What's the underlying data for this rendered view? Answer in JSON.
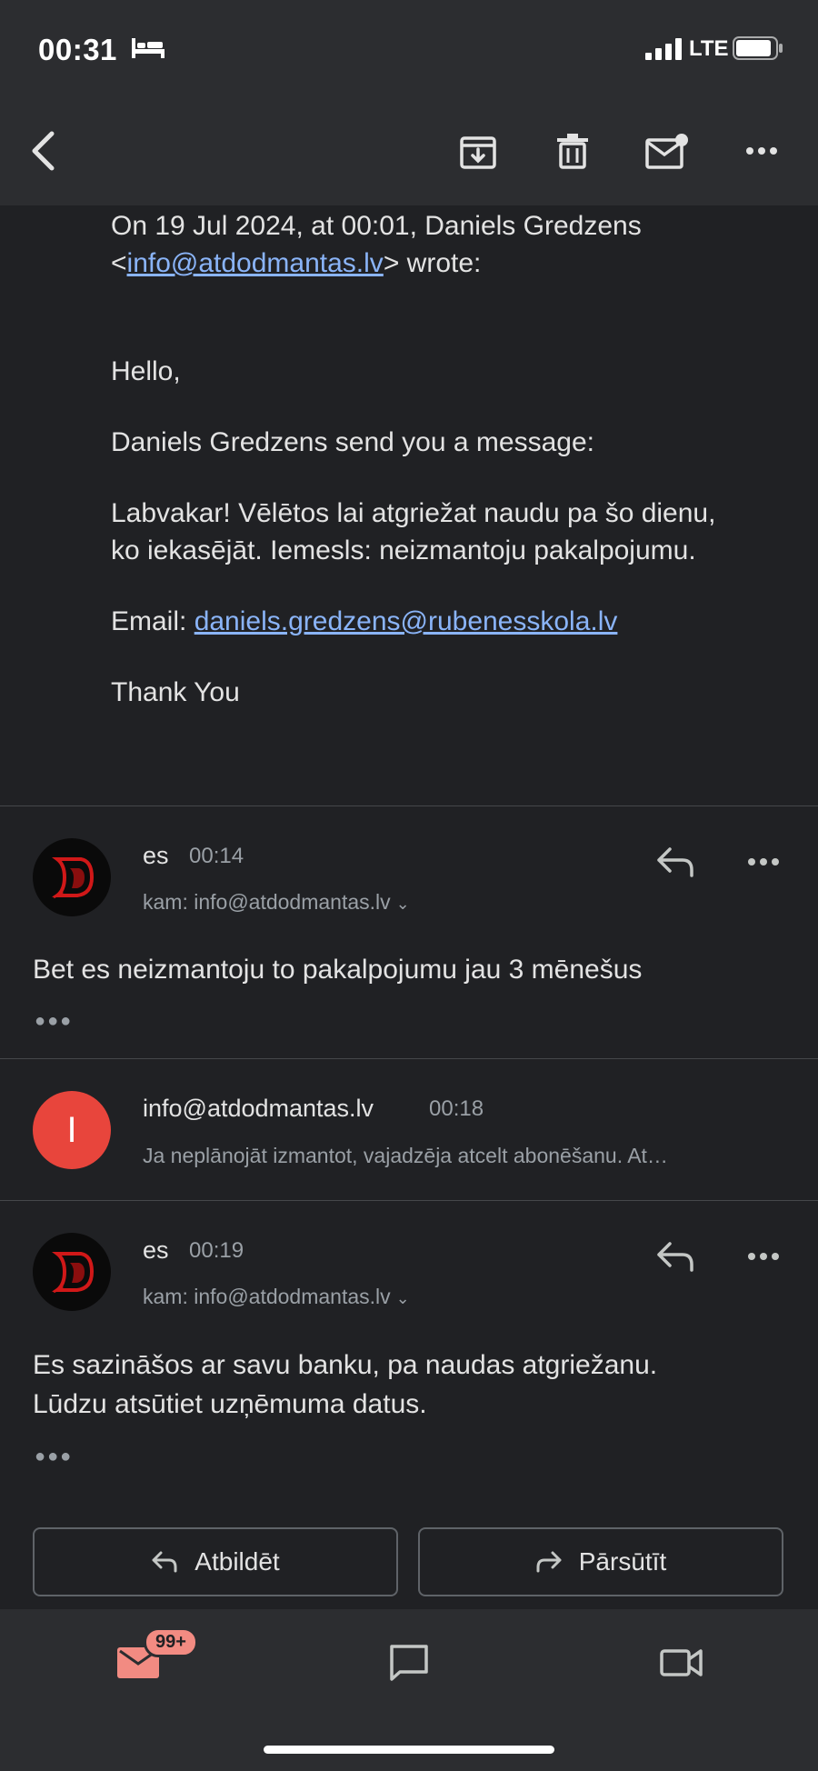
{
  "status": {
    "time": "00:31",
    "network": "LTE"
  },
  "toolbar": {
    "back": "back-icon",
    "archive": "archive-icon",
    "delete": "trash-icon",
    "mark_unread": "mark-unread-icon",
    "more": "more-icon"
  },
  "quoted": {
    "header_prefix": "On 19 Jul 2024, at 00:01, Daniels Gredzens <",
    "header_email": "info@atdodmantas.lv",
    "header_suffix": "> wrote:",
    "greeting": "Hello,",
    "intro": "Daniels Gredzens send you a message:",
    "message": "Labvakar! Vēlētos lai atgriežat naudu pa šo dienu, ko iekasējāt. Iemesls: neizmantoju pakalpojumu.",
    "email_label": "Email: ",
    "email_value": "daniels.gredzens@rubenesskola.lv",
    "closing": "Thank You"
  },
  "messages": [
    {
      "sender": "es",
      "time": "00:14",
      "to": "kam: info@atdodmantas.lv",
      "body": "Bet es neizmantoju to pakalpojumu jau 3 mēnešus"
    },
    {
      "sender": "info@atdodmantas.lv",
      "time": "00:18",
      "avatar_letter": "I",
      "snippet": "Ja neplānojāt izmantot, vajadzēja atcelt abonēšanu. At…"
    },
    {
      "sender": "es",
      "time": "00:19",
      "to": "kam: info@atdodmantas.lv",
      "body_line1": "Es sazināšos ar savu banku, pa naudas atgriežanu.",
      "body_line2": "Lūdzu atsūtiet uzņēmuma datus."
    }
  ],
  "actions": {
    "reply": "Atbildēt",
    "forward": "Pārsūtīt"
  },
  "bottom_nav": {
    "mail_badge": "99+",
    "colors": {
      "badge": "#f28b82",
      "mail_icon": "#f28b82"
    }
  }
}
